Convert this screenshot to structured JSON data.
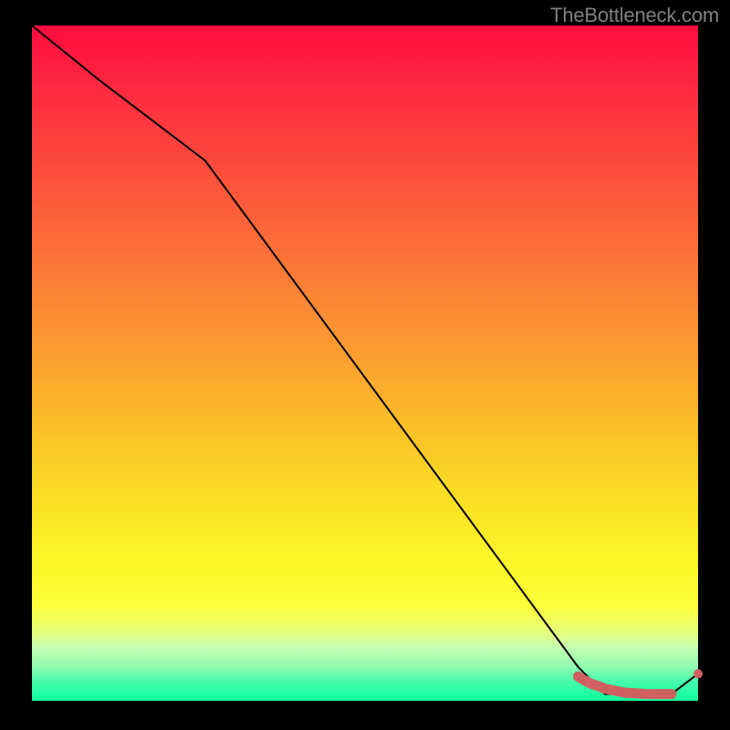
{
  "attribution": "TheBottleneck.com",
  "chart_data": {
    "type": "line",
    "title": "",
    "xlabel": "",
    "ylabel": "",
    "xlim": [
      0,
      100
    ],
    "ylim": [
      0,
      100
    ],
    "x": [
      0,
      10,
      26,
      82,
      86,
      96,
      100
    ],
    "values": [
      100,
      92,
      80,
      5,
      1,
      1,
      4
    ],
    "markers": {
      "cluster_x": [
        82,
        83,
        84,
        85,
        86,
        88,
        89,
        91,
        92,
        94,
        95,
        96
      ],
      "cluster_y": [
        3.6,
        3.0,
        2.5,
        2.2,
        1.8,
        1.4,
        1.2,
        1.1,
        1.0,
        1.0,
        1.0,
        1.0
      ],
      "end_point": {
        "x": 100,
        "y": 4
      }
    },
    "gradient_bands": [
      {
        "y": 100,
        "color": "#ff0c3e"
      },
      {
        "y": 90,
        "color": "#fe2b3f"
      },
      {
        "y": 80,
        "color": "#fd493c"
      },
      {
        "y": 70,
        "color": "#fc6639"
      },
      {
        "y": 60,
        "color": "#fb8435"
      },
      {
        "y": 50,
        "color": "#fba22f"
      },
      {
        "y": 40,
        "color": "#fbc128"
      },
      {
        "y": 30,
        "color": "#fbdf24"
      },
      {
        "y": 20,
        "color": "#fbf829"
      },
      {
        "y": 10,
        "color": "#e4ff7d"
      },
      {
        "y": 5,
        "color": "#8dfbaf"
      },
      {
        "y": 0,
        "color": "#0cff9c"
      }
    ],
    "marker_color": "#d06060",
    "line_color": "#000000"
  }
}
